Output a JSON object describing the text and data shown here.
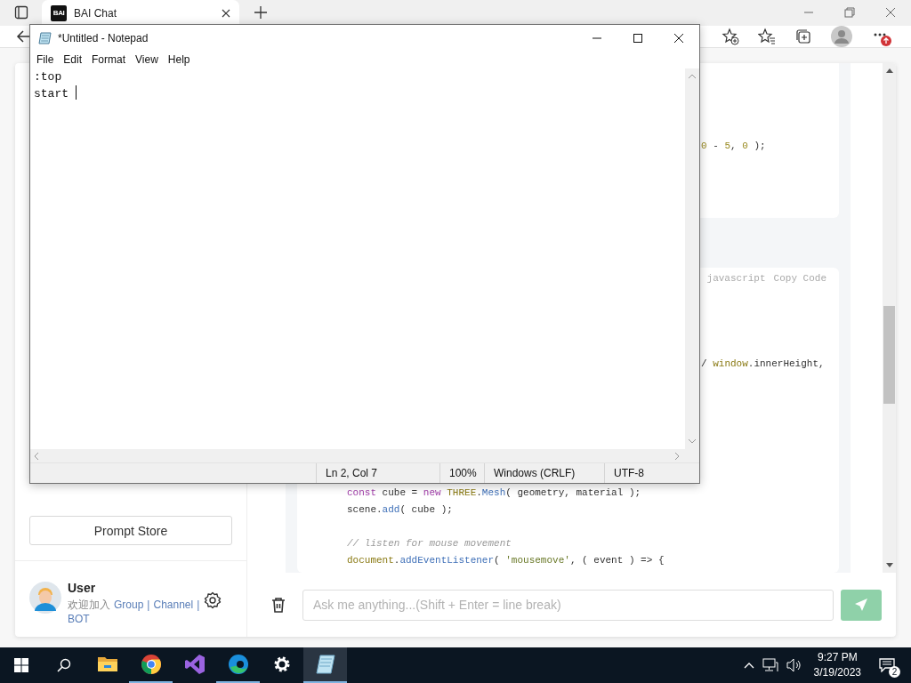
{
  "browser": {
    "tab": {
      "logo": "BAI",
      "title": "BAI Chat",
      "selected": true
    }
  },
  "sidebar": {
    "prompt_store": "Prompt Store",
    "user": {
      "name": "User",
      "welcome": "欢迎加入",
      "links": [
        "Group",
        "Channel",
        "BOT"
      ],
      "separator": "|"
    }
  },
  "chat": {
    "code_blocks": [
      {
        "lines": [
          {
            "kind": "tail",
            "tokens": [
              {
                "kind": "num",
                "text": "0"
              },
              {
                "kind": "plain",
                "text": " - "
              },
              {
                "kind": "num",
                "text": "5"
              },
              {
                "kind": "plain",
                "text": ", "
              },
              {
                "kind": "num",
                "text": "0"
              },
              {
                "kind": "plain",
                "text": " );"
              }
            ]
          }
        ]
      },
      {
        "language": "javascript",
        "copy": "Copy Code",
        "lines": [
          {
            "kind": "tail",
            "tokens": [
              {
                "kind": "plain",
                "text": "/ "
              },
              {
                "kind": "obj",
                "text": "window"
              },
              {
                "kind": "plain",
                "text": ".innerHeight,"
              }
            ]
          },
          {
            "kind": "code",
            "tokens": [
              {
                "kind": "keyword",
                "text": "const"
              },
              {
                "kind": "plain",
                "text": " cube = "
              },
              {
                "kind": "keyword",
                "text": "new"
              },
              {
                "kind": "obj",
                "text": " THREE"
              },
              {
                "kind": "plain",
                "text": "."
              },
              {
                "kind": "fn",
                "text": "Mesh"
              },
              {
                "kind": "plain",
                "text": "( geometry, material );"
              }
            ]
          },
          {
            "kind": "code",
            "tokens": [
              {
                "kind": "plain",
                "text": "scene."
              },
              {
                "kind": "fn",
                "text": "add"
              },
              {
                "kind": "plain",
                "text": "( cube );"
              }
            ]
          },
          {
            "kind": "blank"
          },
          {
            "kind": "code",
            "tokens": [
              {
                "kind": "comment",
                "text": "// listen for mouse movement"
              }
            ]
          },
          {
            "kind": "code",
            "tokens": [
              {
                "kind": "obj",
                "text": "document"
              },
              {
                "kind": "plain",
                "text": "."
              },
              {
                "kind": "fn",
                "text": "addEventListener"
              },
              {
                "kind": "plain",
                "text": "( "
              },
              {
                "kind": "str",
                "text": "'mousemove'"
              },
              {
                "kind": "plain",
                "text": ", ( event ) => {"
              }
            ]
          }
        ]
      }
    ],
    "input": {
      "placeholder": "Ask me anything...(Shift + Enter = line break)"
    },
    "send": {
      "disabled": true
    }
  },
  "notepad": {
    "title": "*Untitled - Notepad",
    "menu": [
      "File",
      "Edit",
      "Format",
      "View",
      "Help"
    ],
    "lines": [
      ":top",
      "start "
    ],
    "status": [
      "Ln 2, Col 7",
      "100%",
      "Windows (CRLF)",
      "UTF-8"
    ]
  },
  "taskbar": {
    "apps": [
      {
        "kind": "explorer",
        "running": false,
        "selected": false
      },
      {
        "kind": "chrome",
        "running": true,
        "selected": false
      },
      {
        "kind": "studio",
        "running": false,
        "selected": false
      },
      {
        "kind": "edge",
        "running": true,
        "selected": false
      },
      {
        "kind": "settings",
        "running": false,
        "selected": false
      },
      {
        "kind": "notepad",
        "running": true,
        "selected": true
      }
    ],
    "time": "9:27 PM",
    "date": "3/19/2023",
    "notifications": "2"
  }
}
